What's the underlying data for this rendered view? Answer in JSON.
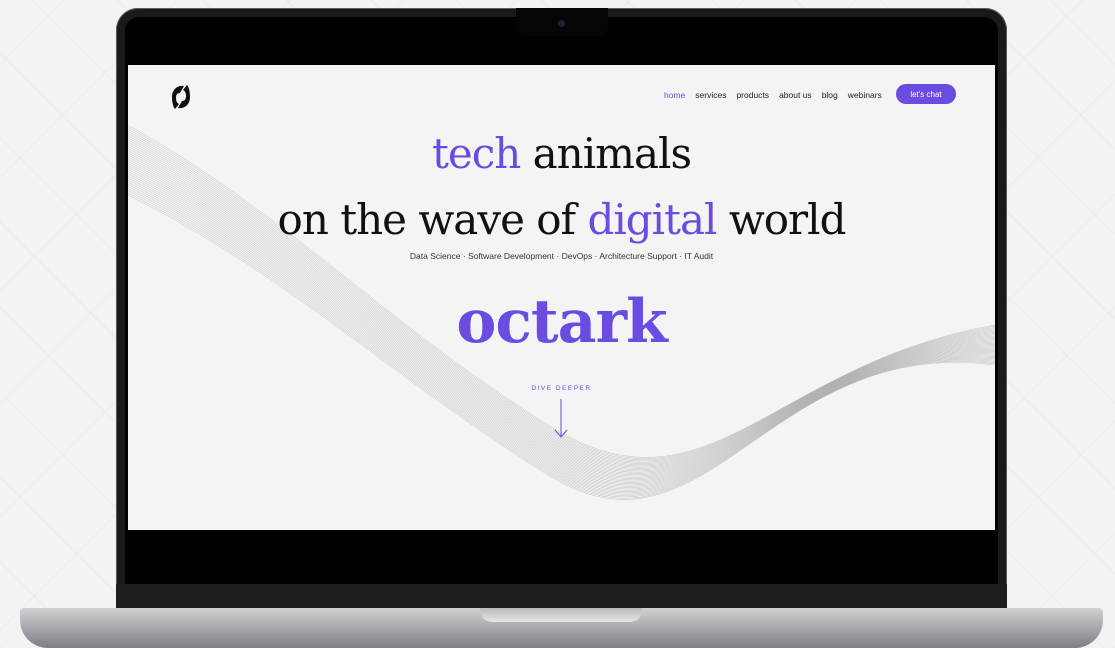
{
  "nav": {
    "items": [
      {
        "label": "home",
        "active": true
      },
      {
        "label": "services",
        "active": false
      },
      {
        "label": "products",
        "active": false
      },
      {
        "label": "about us",
        "active": false
      },
      {
        "label": "blog",
        "active": false
      },
      {
        "label": "webinars",
        "active": false
      }
    ],
    "cta_label": "let's chat"
  },
  "hero": {
    "line1_accent": "tech",
    "line1_rest": " animals",
    "line2_pre": "on the wave of ",
    "line2_accent": "digital",
    "line2_post": " world",
    "subtitle": "Data Science · Software Development · DevOps · Architecture Support · IT Audit",
    "brand": "octark",
    "scroll_label": "DIVE DEEPER"
  },
  "colors": {
    "accent": "#6a4de0",
    "text": "#111111",
    "screen_bg": "#f4f4f5"
  },
  "icons": {
    "logo": "octark-logo-icon",
    "scroll": "arrow-down-icon"
  }
}
